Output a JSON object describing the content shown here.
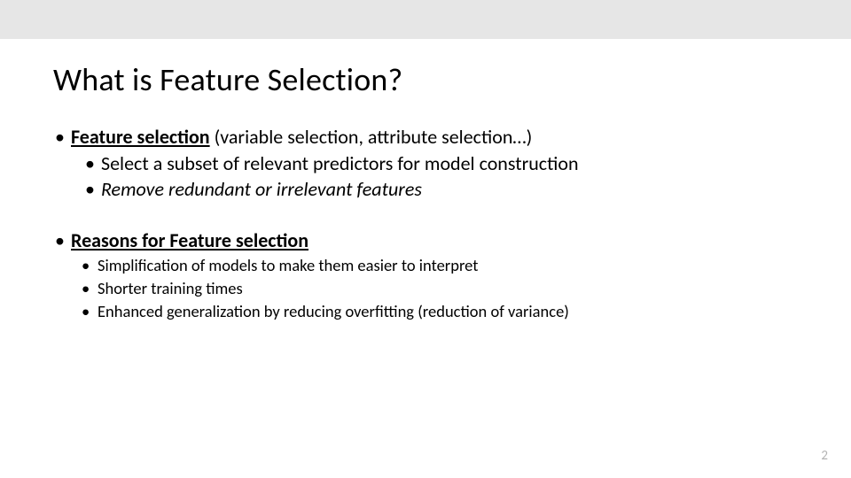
{
  "title": "What is Feature Selection?",
  "section1": {
    "lead_bold_uline": "Feature selection",
    "lead_rest": " (variable selection, attribute selection…)",
    "sub1": "Select a subset of relevant predictors for model construction",
    "sub2": "Remove redundant or irrelevant features"
  },
  "section2": {
    "lead": "Reasons for Feature selection",
    "sub1": "Simplification of models to make them easier to interpret",
    "sub2": "Shorter training times",
    "sub3": "Enhanced generalization by reducing overfitting (reduction of variance)"
  },
  "page_number": "2",
  "bullet_char": "•"
}
